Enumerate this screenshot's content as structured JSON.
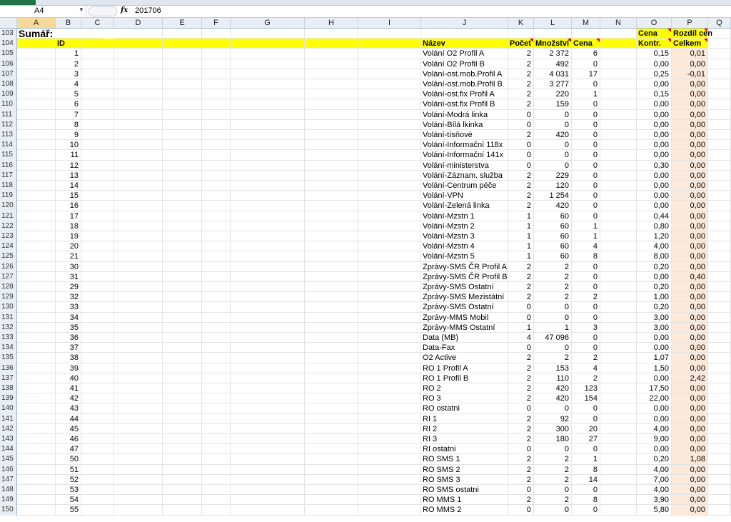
{
  "formula_bar": {
    "name_box": "A4",
    "fx_label": "fx",
    "value": "201706"
  },
  "columns": [
    "A",
    "B",
    "C",
    "D",
    "E",
    "F",
    "G",
    "H",
    "I",
    "J",
    "K",
    "L",
    "M",
    "N",
    "O",
    "P",
    "Q"
  ],
  "selected_column": "A",
  "row103": {
    "num": "103",
    "title": "Sumář:",
    "o": "Cena",
    "p": "Rozdíl cen"
  },
  "row104": {
    "num": "104",
    "id": "ID",
    "j": "Název",
    "k": "Počet",
    "l": "Množství",
    "m": "Cena",
    "o": "Kontr.",
    "p": "Celkem"
  },
  "rows": [
    {
      "n": "105",
      "id": "1",
      "name": "Volání O2 Profil A",
      "k": "2",
      "l": "2 372",
      "m": "6",
      "o": "0,15",
      "p": "0,01"
    },
    {
      "n": "106",
      "id": "2",
      "name": "Volání O2 Profil B",
      "k": "2",
      "l": "492",
      "m": "0",
      "o": "0,00",
      "p": "0,00"
    },
    {
      "n": "107",
      "id": "3",
      "name": "Volání-ost.mob.Profil A",
      "k": "2",
      "l": "4 031",
      "m": "17",
      "o": "0,25",
      "p": "-0,01"
    },
    {
      "n": "108",
      "id": "4",
      "name": "Volání-ost.mob.Profil B",
      "k": "2",
      "l": "3 277",
      "m": "0",
      "o": "0,00",
      "p": "0,00"
    },
    {
      "n": "109",
      "id": "5",
      "name": "Volání-ost.fix Profil A",
      "k": "2",
      "l": "220",
      "m": "1",
      "o": "0,15",
      "p": "0,00"
    },
    {
      "n": "110",
      "id": "6",
      "name": "Volání-ost.fix Profil B",
      "k": "2",
      "l": "159",
      "m": "0",
      "o": "0,00",
      "p": "0,00"
    },
    {
      "n": "111",
      "id": "7",
      "name": "Volání-Modrá linka",
      "k": "0",
      "l": "0",
      "m": "0",
      "o": "0,00",
      "p": "0,00"
    },
    {
      "n": "112",
      "id": "8",
      "name": "Volání-Bílá lkinka",
      "k": "0",
      "l": "0",
      "m": "0",
      "o": "0,00",
      "p": "0,00"
    },
    {
      "n": "113",
      "id": "9",
      "name": "Volání-tísňové",
      "k": "2",
      "l": "420",
      "m": "0",
      "o": "0,00",
      "p": "0,00"
    },
    {
      "n": "114",
      "id": "10",
      "name": "Volání-Informační 118x",
      "k": "0",
      "l": "0",
      "m": "0",
      "o": "0,00",
      "p": "0,00"
    },
    {
      "n": "115",
      "id": "11",
      "name": "Volání-Informační 141x",
      "k": "0",
      "l": "0",
      "m": "0",
      "o": "0,00",
      "p": "0,00"
    },
    {
      "n": "116",
      "id": "12",
      "name": "Volání-ministerstva",
      "k": "0",
      "l": "0",
      "m": "0",
      "o": "0,30",
      "p": "0,00"
    },
    {
      "n": "117",
      "id": "13",
      "name": "Volání-Záznam. služba",
      "k": "2",
      "l": "229",
      "m": "0",
      "o": "0,00",
      "p": "0,00"
    },
    {
      "n": "118",
      "id": "14",
      "name": "Volání-Centrum péče",
      "k": "2",
      "l": "120",
      "m": "0",
      "o": "0,00",
      "p": "0,00"
    },
    {
      "n": "119",
      "id": "15",
      "name": "Volání-VPN",
      "k": "2",
      "l": "1 254",
      "m": "0",
      "o": "0,00",
      "p": "0,00"
    },
    {
      "n": "120",
      "id": "16",
      "name": "Volání-Zelená linka",
      "k": "2",
      "l": "420",
      "m": "0",
      "o": "0,00",
      "p": "0,00"
    },
    {
      "n": "121",
      "id": "17",
      "name": "Volání-Mzstn 1",
      "k": "1",
      "l": "60",
      "m": "0",
      "o": "0,44",
      "p": "0,00"
    },
    {
      "n": "122",
      "id": "18",
      "name": "Volání-Mzstn 2",
      "k": "1",
      "l": "60",
      "m": "1",
      "o": "0,80",
      "p": "0,00"
    },
    {
      "n": "123",
      "id": "19",
      "name": "Volání-Mzstn 3",
      "k": "1",
      "l": "60",
      "m": "1",
      "o": "1,20",
      "p": "0,00"
    },
    {
      "n": "124",
      "id": "20",
      "name": "Volání-Mzstn 4",
      "k": "1",
      "l": "60",
      "m": "4",
      "o": "4,00",
      "p": "0,00"
    },
    {
      "n": "125",
      "id": "21",
      "name": "Volání-Mzstn 5",
      "k": "1",
      "l": "60",
      "m": "8",
      "o": "8,00",
      "p": "0,00"
    },
    {
      "n": "126",
      "id": "30",
      "name": "Zprávy-SMS ČR Profil A",
      "k": "2",
      "l": "2",
      "m": "0",
      "o": "0,20",
      "p": "0,00"
    },
    {
      "n": "127",
      "id": "31",
      "name": "Zprávy-SMS ČR Profil B",
      "k": "2",
      "l": "2",
      "m": "0",
      "o": "0,00",
      "p": "0,40"
    },
    {
      "n": "128",
      "id": "29",
      "name": "Zprávy-SMS Ostatní",
      "k": "2",
      "l": "2",
      "m": "0",
      "o": "0,20",
      "p": "0,00"
    },
    {
      "n": "129",
      "id": "32",
      "name": "Zprávy-SMS Mezistátní",
      "k": "2",
      "l": "2",
      "m": "2",
      "o": "1,00",
      "p": "0,00"
    },
    {
      "n": "130",
      "id": "33",
      "name": "Zprávy-SMS Ostatní",
      "k": "0",
      "l": "0",
      "m": "0",
      "o": "0,20",
      "p": "0,00"
    },
    {
      "n": "131",
      "id": "34",
      "name": "Zprávy-MMS Mobil",
      "k": "0",
      "l": "0",
      "m": "0",
      "o": "3,00",
      "p": "0,00"
    },
    {
      "n": "132",
      "id": "35",
      "name": "Zprávy-MMS Ostatní",
      "k": "1",
      "l": "1",
      "m": "3",
      "o": "3,00",
      "p": "0,00"
    },
    {
      "n": "133",
      "id": "36",
      "name": "Data (MB)",
      "k": "4",
      "l": "47 096",
      "m": "0",
      "o": "0,00",
      "p": "0,00"
    },
    {
      "n": "134",
      "id": "37",
      "name": "Data-Fax",
      "k": "0",
      "l": "0",
      "m": "0",
      "o": "0,00",
      "p": "0,00"
    },
    {
      "n": "135",
      "id": "38",
      "name": "O2 Active",
      "k": "2",
      "l": "2",
      "m": "2",
      "o": "1,07",
      "p": "0,00"
    },
    {
      "n": "136",
      "id": "39",
      "name": "RO 1 Profil A",
      "k": "2",
      "l": "153",
      "m": "4",
      "o": "1,50",
      "p": "0,00"
    },
    {
      "n": "137",
      "id": "40",
      "name": "RO 1 Profil B",
      "k": "2",
      "l": "110",
      "m": "2",
      "o": "0,00",
      "p": "2,42"
    },
    {
      "n": "138",
      "id": "41",
      "name": "RO 2",
      "k": "2",
      "l": "420",
      "m": "123",
      "o": "17,50",
      "p": "0,00"
    },
    {
      "n": "139",
      "id": "42",
      "name": "RO 3",
      "k": "2",
      "l": "420",
      "m": "154",
      "o": "22,00",
      "p": "0,00"
    },
    {
      "n": "140",
      "id": "43",
      "name": "RO ostatni",
      "k": "0",
      "l": "0",
      "m": "0",
      "o": "0,00",
      "p": "0,00"
    },
    {
      "n": "141",
      "id": "44",
      "name": "RI 1",
      "k": "2",
      "l": "92",
      "m": "0",
      "o": "0,00",
      "p": "0,00"
    },
    {
      "n": "142",
      "id": "45",
      "name": "RI 2",
      "k": "2",
      "l": "300",
      "m": "20",
      "o": "4,00",
      "p": "0,00"
    },
    {
      "n": "143",
      "id": "46",
      "name": "RI 3",
      "k": "2",
      "l": "180",
      "m": "27",
      "o": "9,00",
      "p": "0,00"
    },
    {
      "n": "144",
      "id": "47",
      "name": "RI ostatni",
      "k": "0",
      "l": "0",
      "m": "0",
      "o": "0,00",
      "p": "0,00"
    },
    {
      "n": "145",
      "id": "50",
      "name": "RO SMS 1",
      "k": "2",
      "l": "2",
      "m": "1",
      "o": "0,20",
      "p": "1,08"
    },
    {
      "n": "146",
      "id": "51",
      "name": "RO SMS 2",
      "k": "2",
      "l": "2",
      "m": "8",
      "o": "4,00",
      "p": "0,00"
    },
    {
      "n": "147",
      "id": "52",
      "name": "RO SMS 3",
      "k": "2",
      "l": "2",
      "m": "14",
      "o": "7,00",
      "p": "0,00"
    },
    {
      "n": "148",
      "id": "53",
      "name": "RO SMS ostatni",
      "k": "0",
      "l": "0",
      "m": "0",
      "o": "4,00",
      "p": "0,00"
    },
    {
      "n": "149",
      "id": "54",
      "name": "RO MMS 1",
      "k": "2",
      "l": "2",
      "m": "8",
      "o": "3,90",
      "p": "0,00"
    },
    {
      "n": "150",
      "id": "55",
      "name": "RO MMS 2",
      "k": "0",
      "l": "0",
      "m": "0",
      "o": "5,80",
      "p": "0,00"
    }
  ],
  "colors": {
    "header_yellow": "#ffff00",
    "diff_column": "#fde9d9",
    "selected_header": "#f9d99a"
  }
}
